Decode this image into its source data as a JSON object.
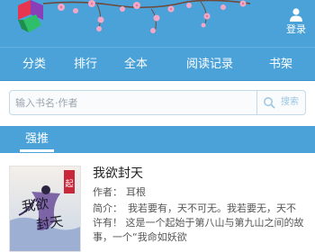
{
  "header": {
    "login_label": "登录"
  },
  "nav": {
    "items": [
      {
        "label": "分类"
      },
      {
        "label": "排行"
      },
      {
        "label": "全本"
      },
      {
        "label": "阅读记录"
      },
      {
        "label": "书架"
      }
    ]
  },
  "search": {
    "placeholder": "输入书名·作者",
    "button_label": "搜索"
  },
  "section": {
    "title": "强推"
  },
  "book": {
    "title": "我欲封天",
    "author_label": "作者：",
    "author": "耳根",
    "intro_label": "简介：",
    "intro": "我若要有，天不可无。我若要无，天不许有！ 这是一个起始于第八山与第九山之间的故事，一个“我命如妖欲",
    "cover_text": "我欲封天"
  },
  "colors": {
    "header_blue": "#4aa2d8",
    "blossom_pink": "#f4a7c6",
    "logo_red": "#e8354f",
    "logo_purple": "#8a3fb8",
    "logo_green": "#2fbf6a"
  },
  "icons": {
    "login": "user-icon",
    "search": "search-icon",
    "logo": "logo-icon"
  }
}
